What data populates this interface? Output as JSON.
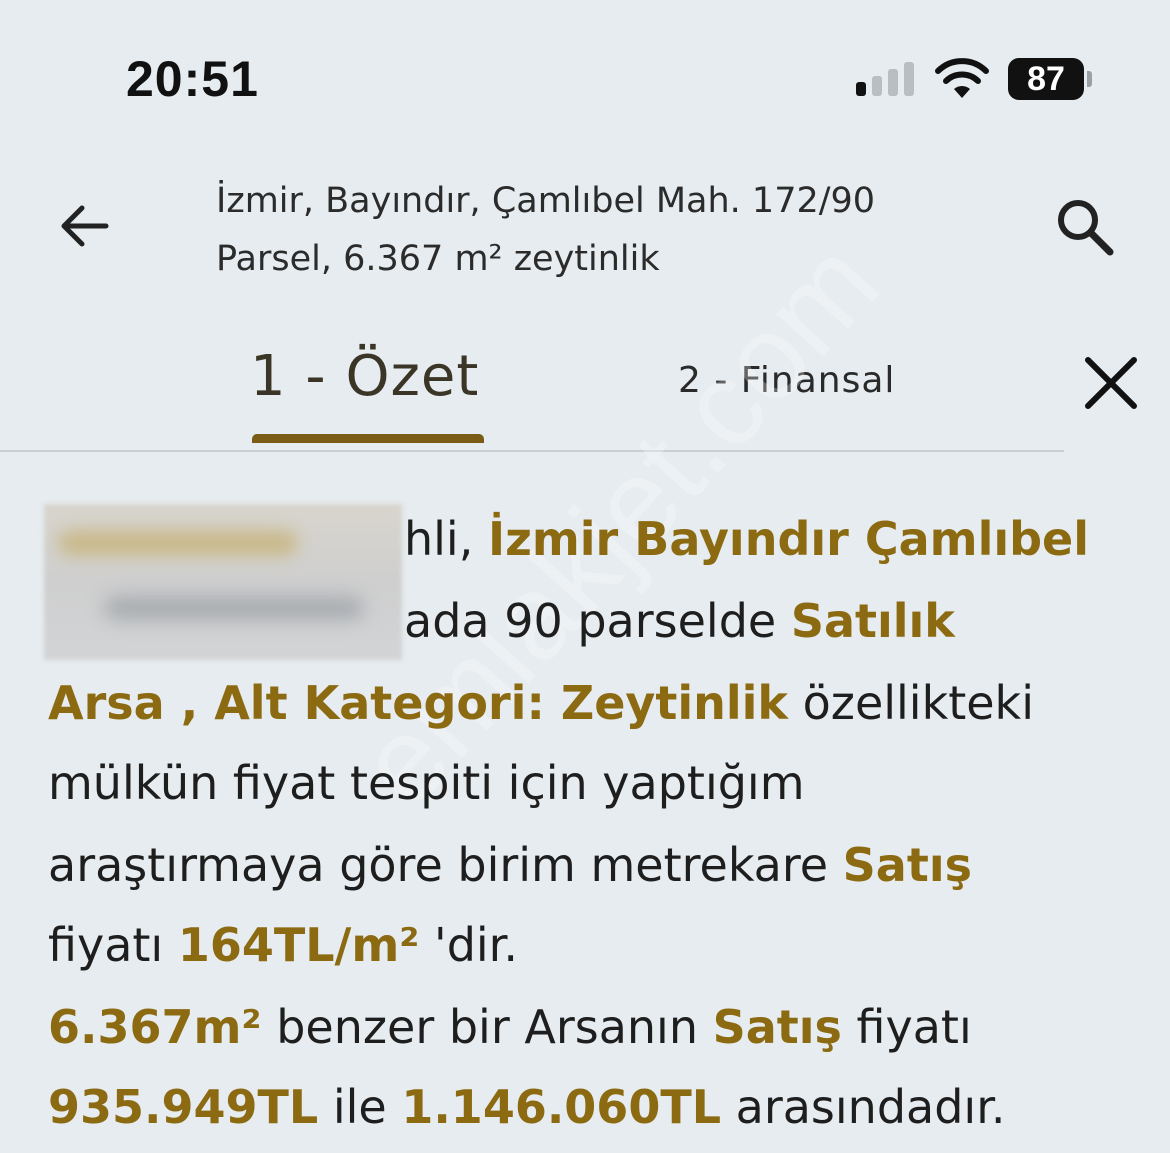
{
  "status_bar": {
    "time": "20:51",
    "battery": "87"
  },
  "header": {
    "title_line1": "İzmir, Bayındır, Çamlıbel Mah. 172/90",
    "title_line2": "Parsel, 6.367 m² zeytinlik"
  },
  "tabs": [
    {
      "label": "1 - Özet",
      "active": true
    },
    {
      "label": "2 - Finansal",
      "active": false
    }
  ],
  "icons": {
    "back": "arrow-left-icon",
    "search": "search-icon",
    "close": "close-icon"
  },
  "colors": {
    "highlight": "#8c6a12",
    "background": "#e6ecef",
    "tab_underline": "#7a5c14"
  },
  "body": {
    "l1_a": "hli, ",
    "l1_b": "İzmir Bayındır Çamlıbel",
    "l2_a": "ada 90  parselde ",
    "l2_b": "Satılık",
    "l3_a": "Arsa , Alt Kategori: Zeytinlik",
    "l3_b": " özellikteki",
    "l4": "mülkün fiyat tespiti için  yaptığım",
    "l5_a": "araştırmaya göre birim metrekare ",
    "l5_b": "Satış",
    "l6_a": "fiyatı ",
    "l6_b": "164TL/m²",
    "l6_c": " 'dir.",
    "l7_a": "6.367m²",
    "l7_b": " benzer bir Arsanın  ",
    "l7_c": "Satış",
    "l7_d": " fiyatı",
    "l8_a": "935.949TL",
    "l8_b": " ile ",
    "l8_c": "1.146.060TL",
    "l8_d": " arasındadır."
  },
  "watermark": "emlakjet.com"
}
